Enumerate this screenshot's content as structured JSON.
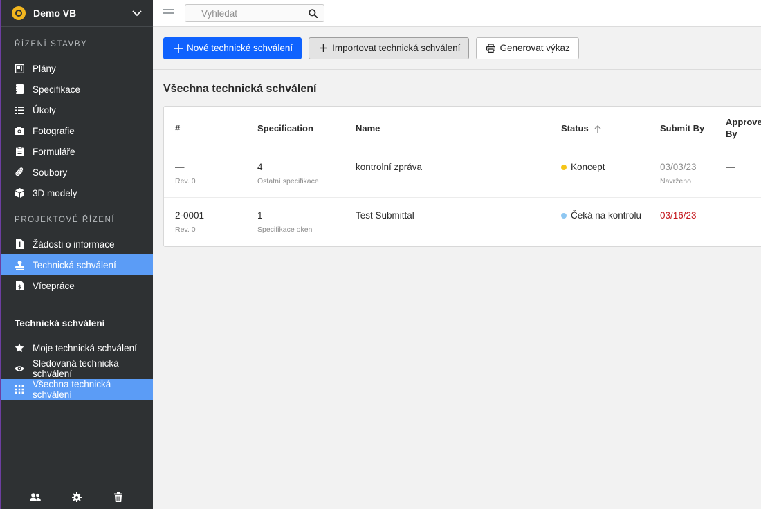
{
  "sidebar": {
    "project_name": "Demo VB",
    "section1": "ŘÍZENÍ STAVBY",
    "items1": [
      {
        "label": "Plány",
        "icon": "plans-icon"
      },
      {
        "label": "Specifikace",
        "icon": "specification-icon"
      },
      {
        "label": "Úkoly",
        "icon": "list-icon"
      },
      {
        "label": "Fotografie",
        "icon": "camera-icon"
      },
      {
        "label": "Formuláře",
        "icon": "clipboard-icon"
      },
      {
        "label": "Soubory",
        "icon": "paperclip-icon"
      },
      {
        "label": "3D modely",
        "icon": "cube-icon"
      }
    ],
    "section2": "PROJEKTOVÉ ŘÍZENÍ",
    "items2": [
      {
        "label": "Žádosti o informace",
        "icon": "info-document-icon"
      },
      {
        "label": "Technická schválení",
        "icon": "stamp-icon"
      },
      {
        "label": "Vícepráce",
        "icon": "money-document-icon"
      }
    ],
    "subsection": "Technická schválení",
    "items3": [
      {
        "label": "Moje technická schválení",
        "icon": "star-icon"
      },
      {
        "label": "Sledovaná technická schválení",
        "icon": "eye-icon"
      },
      {
        "label": "Všechna technická schválení",
        "icon": "grid-icon"
      }
    ]
  },
  "topbar": {
    "search_placeholder": "Vyhledat"
  },
  "toolbar": {
    "new_label": "Nové technické schválení",
    "import_label": "Importovat technická schválení",
    "report_label": "Generovat výkaz"
  },
  "main": {
    "title": "Všechna technická schválení",
    "columns": [
      "#",
      "Specification",
      "Name",
      "Status",
      "Submit By",
      "Approve By"
    ],
    "rows": [
      {
        "number": "—",
        "rev": "Rev. 0",
        "spec": "4",
        "spec_name": "Ostatní specifikace",
        "name": "kontrolní zpráva",
        "status": "Koncept",
        "status_color": "#f5c518",
        "submit": "03/03/23",
        "submit_sub": "Navrženo",
        "approve": "—"
      },
      {
        "number": "2-0001",
        "rev": "Rev. 0",
        "spec": "1",
        "spec_name": "Specifikace oken",
        "name": "Test Submittal",
        "status": "Čeká na kontrolu",
        "status_color": "#8ec7f2",
        "submit": "03/16/23",
        "submit_sub": "",
        "approve": "—"
      }
    ]
  },
  "colors": {
    "accent": "#5b9cf6",
    "primary_button": "#0f62fe",
    "sidebar_bg": "#2e3133",
    "overdue": "#c4161c"
  }
}
